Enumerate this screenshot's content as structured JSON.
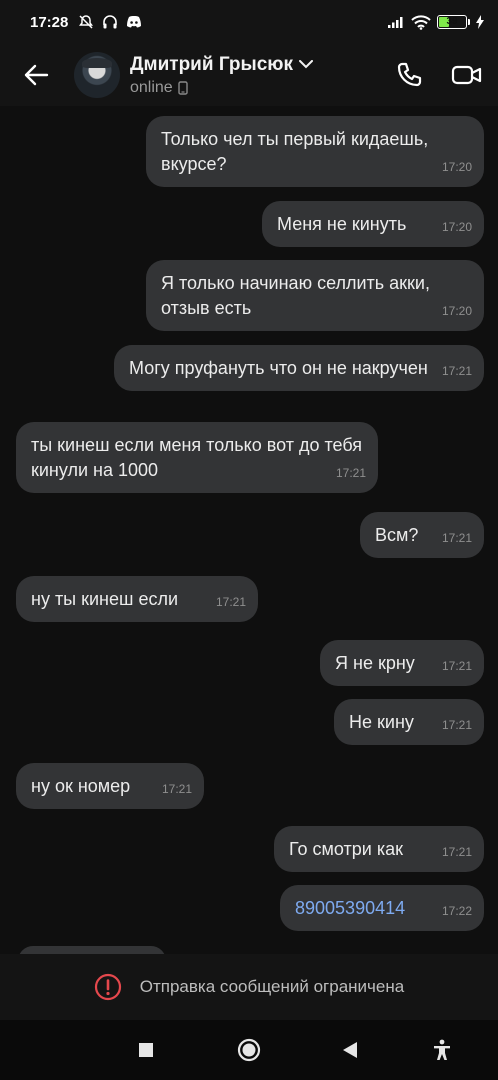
{
  "status_bar": {
    "time": "17:28",
    "battery": "39"
  },
  "header": {
    "contact_name": "Дмитрий Грысюк",
    "status": "online"
  },
  "messages": [
    {
      "dir": "out",
      "text": "Только чел ты первый кидаешь, вкурсе?",
      "time": "17:20"
    },
    {
      "dir": "out",
      "text": "Меня не кинуть",
      "time": "17:20"
    },
    {
      "dir": "out",
      "text": "Я только начинаю селлить акки, отзыв есть",
      "time": "17:20"
    },
    {
      "dir": "out",
      "text": "Могу пруфануть что он не накручен",
      "time": "17:21"
    },
    {
      "dir": "in",
      "text": "ты кинеш если меня только вот до тебя кинули на 1000",
      "time": "17:21"
    },
    {
      "dir": "out",
      "text": "Всм?",
      "time": "17:21"
    },
    {
      "dir": "in",
      "text": "ну ты кинеш если",
      "time": "17:21"
    },
    {
      "dir": "out",
      "text": "Я не крну",
      "time": "17:21"
    },
    {
      "dir": "out",
      "text": "Не кину",
      "time": "17:21"
    },
    {
      "dir": "in",
      "text": "ну ок номер",
      "time": "17:21"
    },
    {
      "dir": "out",
      "text": "Го смотри как",
      "time": "17:21"
    },
    {
      "dir": "out",
      "text": "89005390414",
      "time": "17:22",
      "link": true
    }
  ],
  "restriction": {
    "text": "Отправка сообщений ограничена"
  },
  "colors": {
    "bubble": "#333436",
    "background": "#0f0f0f",
    "link": "#7eaaf0",
    "warning": "#e5484d"
  },
  "icons": [
    "back-arrow-icon",
    "phone-icon",
    "video-camera-icon",
    "warning-icon",
    "nav-recents-icon",
    "nav-home-icon",
    "nav-back-icon",
    "accessibility-icon"
  ]
}
